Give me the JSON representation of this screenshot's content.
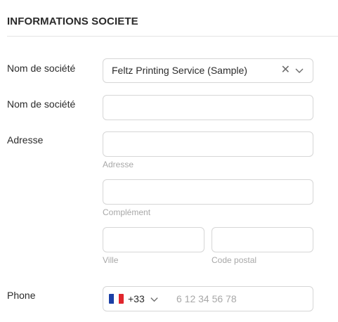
{
  "section": {
    "title": "INFORMATIONS SOCIETE"
  },
  "company_select": {
    "label": "Nom de société",
    "value": "Feltz Printing Service (Sample)",
    "clear_icon": "close-icon",
    "chevron_icon": "chevron-down-icon"
  },
  "company_name": {
    "label": "Nom de société",
    "value": ""
  },
  "address": {
    "label": "Adresse",
    "street_hint": "Adresse",
    "complement_hint": "Complément",
    "city_hint": "Ville",
    "postal_hint": "Code postal"
  },
  "phone": {
    "label": "Phone",
    "country_code": "+33",
    "placeholder": "6 12 34 56 78",
    "flag_colors": [
      "#1b3fa6",
      "#ffffff",
      "#e0262d"
    ],
    "chevron_icon": "chevron-down-icon"
  }
}
